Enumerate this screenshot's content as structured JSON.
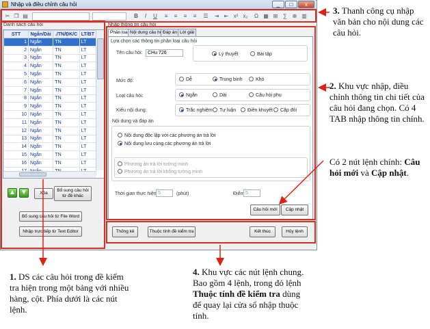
{
  "window": {
    "title": "Nhập và điều chỉnh câu hỏi",
    "min": "_",
    "max": "□",
    "close": "x"
  },
  "left": {
    "section_title": "Danh sách câu hỏi",
    "columns": [
      "STT",
      "Ngắn/Dài",
      "./TN/ĐK/C",
      "LT/BT"
    ],
    "rows": [
      [
        "1",
        "Ngắn",
        "TN",
        "LT"
      ],
      [
        "2",
        "Ngắn",
        "TN",
        "LT"
      ],
      [
        "3",
        "Ngắn",
        "TN",
        "LT"
      ],
      [
        "4",
        "Ngắn",
        "TN",
        "LT"
      ],
      [
        "5",
        "Ngắn",
        "TN",
        "LT"
      ],
      [
        "6",
        "Ngắn",
        "TN",
        "LT"
      ],
      [
        "7",
        "Ngắn",
        "TN",
        "LT"
      ],
      [
        "8",
        "Ngắn",
        "TN",
        "LT"
      ],
      [
        "9",
        "Ngắn",
        "TN",
        "LT"
      ],
      [
        "10",
        "Ngắn",
        "TN",
        "LT"
      ],
      [
        "11",
        "Ngắn",
        "TN",
        "LT"
      ],
      [
        "12",
        "Ngắn",
        "TN",
        "LT"
      ],
      [
        "13",
        "Ngắn",
        "TN",
        "LT"
      ],
      [
        "14",
        "Ngắn",
        "TN",
        "LT"
      ],
      [
        "15",
        "Ngắn",
        "TN",
        "LT"
      ],
      [
        "16",
        "Ngắn",
        "TN",
        "LT"
      ],
      [
        "17",
        "Ngắn",
        "TN",
        "LT"
      ]
    ],
    "up_icon": "▲",
    "down_icon": "▼",
    "delete_label": "Xóa",
    "add_from_other_label": "Bổ sung câu hỏi từ đề khác",
    "add_from_word_label": "Bổ sung câu hỏi từ File Word",
    "import_text_label": "Nhập trực tiếp từ Text Editor"
  },
  "right": {
    "section_title": "Nhập thông tin câu hỏi",
    "tabs": [
      "Phân loại",
      "Nội dung câu hỏi",
      "Đáp án",
      "Lời giải"
    ],
    "group1_title": "Lựa chọn các thông tin phân loại câu hỏi",
    "question_name_label": "Tên câu hỏi:",
    "question_name_value": "CHu 726",
    "theory_label": "Lý thuyết",
    "exercise_label": "Bài tập",
    "level_label": "Mức độ:",
    "easy": "Dễ",
    "medium": "Trung bình",
    "hard": "Khó",
    "type_label": "Loại câu hỏi:",
    "short": "Ngắn",
    "long": "Dài",
    "child": "Câu hỏi phụ",
    "content_type_label": "Kiểu nội dung:",
    "mc": "Trắc nghiệm",
    "essay": "Tự luận",
    "fill": "Điền khuyết",
    "pair": "Cặp đôi",
    "group2_title": "Nội dung và đáp án",
    "independent": "Nội dung độc lập với các phương án trả lời",
    "together": "Nội dung lưu cùng các phương án trả lời",
    "explicit": "Phương án trả lời tường minh",
    "implicit": "Phương án trả lời không tường minh",
    "time_label": "Thời gian thực hiện:",
    "time_value": "5",
    "time_unit": "(phút)",
    "score_label": "Điểm",
    "score_value": "5",
    "new_button": "Câu hỏi mới",
    "update_button": "Cập nhật"
  },
  "bottom": {
    "stats": "Thống kê",
    "props": "Thuộc tính đề kiểm tra",
    "finish": "Kết thúc",
    "cancel": "Hủy lệnh"
  },
  "notes": {
    "n3_num": "3.",
    "n3_text": "Thanh công cụ nhập văn bản cho nội dung các câu hỏi.",
    "n2_num": "2.",
    "n2_text": "Khu vực nhập, điều chỉnh thông tin chi tiết của câu hỏi đang chọn. Có 4 TAB nhập thông tin chính.",
    "n2b_pre": "Có 2 nút lệnh chính: ",
    "n2b_b1": "Câu hỏi mới",
    "n2b_mid": " và ",
    "n2b_b2": "Cập nhật",
    "n2b_end": ".",
    "n1_num": "1.",
    "n1_text": "DS các câu hỏi trong đề kiểm tra hiện trong một bảng với nhiều hàng, cột. Phía dưới là các nút lệnh.",
    "n4_num": "4.",
    "n4_pre": "Khu vực các nút lệnh chung. Bao gồm 4 lệnh, trong đó lệnh ",
    "n4_bold": "Thuộc tính đề kiểm tra",
    "n4_post": " dùng để quay lại cửa sổ nhập thuộc tính."
  }
}
